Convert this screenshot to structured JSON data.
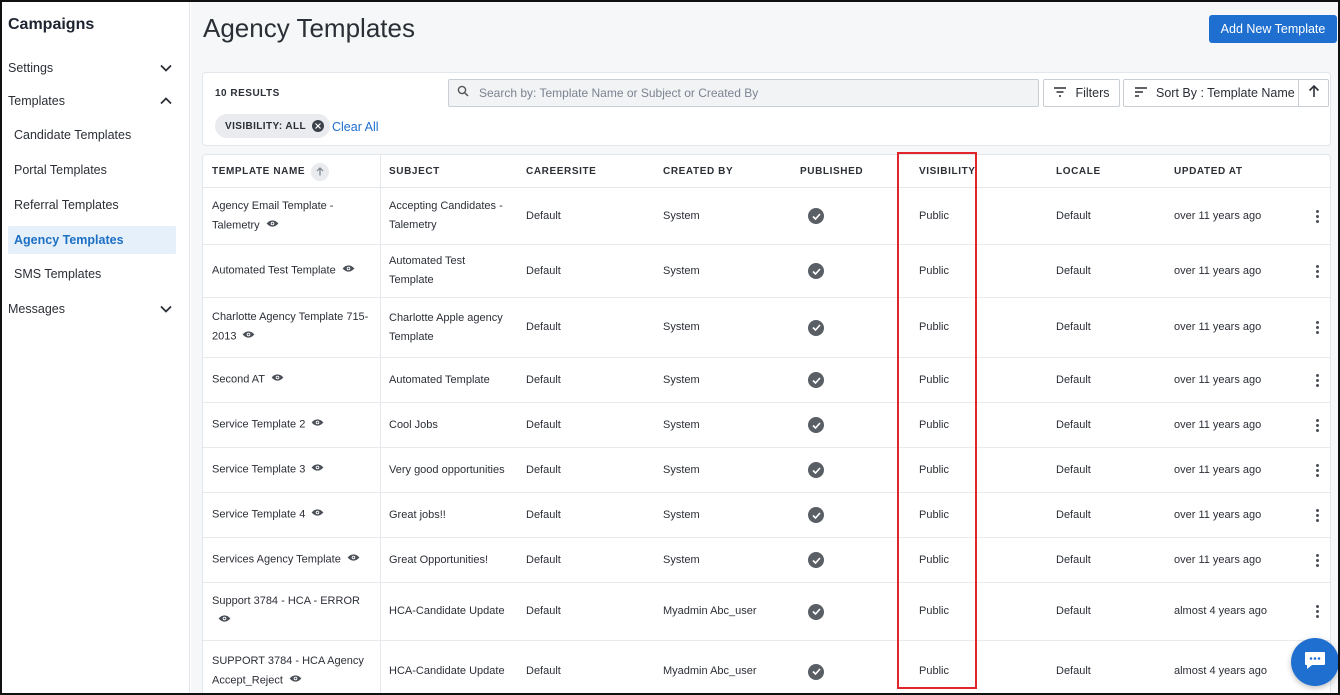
{
  "sidebar": {
    "title": "Campaigns",
    "sections": [
      {
        "label": "Settings",
        "expanded": false
      },
      {
        "label": "Templates",
        "expanded": true
      },
      {
        "label": "Messages",
        "expanded": false
      }
    ],
    "template_items": [
      {
        "label": "Candidate Templates",
        "active": false
      },
      {
        "label": "Portal Templates",
        "active": false
      },
      {
        "label": "Referral Templates",
        "active": false
      },
      {
        "label": "Agency Templates",
        "active": true
      },
      {
        "label": "SMS Templates",
        "active": false
      }
    ]
  },
  "header": {
    "title": "Agency Templates",
    "add_button": "Add New Template"
  },
  "toolbar": {
    "results": "10 RESULTS",
    "search_placeholder": "Search by: Template Name or Subject or Created By",
    "filters_label": "Filters",
    "sort_label": "Sort By : Template Name",
    "chip_label": "VISIBILITY: ALL",
    "clear_all": "Clear All"
  },
  "table": {
    "columns": [
      "TEMPLATE NAME",
      "SUBJECT",
      "CAREERSITE",
      "CREATED BY",
      "PUBLISHED",
      "VISIBILITY",
      "LOCALE",
      "UPDATED AT"
    ],
    "rows": [
      {
        "name": "Agency Email Template - Talemetry",
        "subject": "Accepting Candidates - Talemetry",
        "careersite": "Default",
        "created_by": "System",
        "published": true,
        "visibility": "Public",
        "locale": "Default",
        "updated_at": "over 11 years ago"
      },
      {
        "name": "Automated Test Template",
        "subject": "Automated Test Template",
        "careersite": "Default",
        "created_by": "System",
        "published": true,
        "visibility": "Public",
        "locale": "Default",
        "updated_at": "over 11 years ago"
      },
      {
        "name": "Charlotte Agency Template 715-2013",
        "subject": "Charlotte Apple agency Template",
        "careersite": "Default",
        "created_by": "System",
        "published": true,
        "visibility": "Public",
        "locale": "Default",
        "updated_at": "over 11 years ago"
      },
      {
        "name": "Second AT",
        "subject": "Automated Template",
        "careersite": "Default",
        "created_by": "System",
        "published": true,
        "visibility": "Public",
        "locale": "Default",
        "updated_at": "over 11 years ago"
      },
      {
        "name": "Service Template 2",
        "subject": "Cool Jobs",
        "careersite": "Default",
        "created_by": "System",
        "published": true,
        "visibility": "Public",
        "locale": "Default",
        "updated_at": "over 11 years ago"
      },
      {
        "name": "Service Template 3",
        "subject": "Very good opportunities",
        "careersite": "Default",
        "created_by": "System",
        "published": true,
        "visibility": "Public",
        "locale": "Default",
        "updated_at": "over 11 years ago"
      },
      {
        "name": "Service Template 4",
        "subject": "Great jobs!!",
        "careersite": "Default",
        "created_by": "System",
        "published": true,
        "visibility": "Public",
        "locale": "Default",
        "updated_at": "over 11 years ago"
      },
      {
        "name": "Services Agency Template",
        "subject": "Great Opportunities!",
        "careersite": "Default",
        "created_by": "System",
        "published": true,
        "visibility": "Public",
        "locale": "Default",
        "updated_at": "over 11 years ago"
      },
      {
        "name": "Support 3784 - HCA - ERROR",
        "subject": "HCA-Candidate Update",
        "careersite": "Default",
        "created_by": "Myadmin Abc_user",
        "published": true,
        "visibility": "Public",
        "locale": "Default",
        "updated_at": "almost 4 years ago"
      },
      {
        "name": "SUPPORT 3784 - HCA Agency Accept_Reject",
        "subject": "HCA-Candidate Update",
        "careersite": "Default",
        "created_by": "Myadmin Abc_user",
        "published": true,
        "visibility": "Public",
        "locale": "Default",
        "updated_at": "almost 4 years ago"
      }
    ]
  },
  "icons": {
    "search": "search-icon",
    "filter": "filter-icon",
    "sort": "sort-icon",
    "sort_direction": "arrow-up-icon",
    "preview": "eye-icon",
    "published": "check-circle-icon",
    "row_menu": "kebab-menu-icon",
    "chat": "chat-icon"
  },
  "colors": {
    "accent": "#1f6fd0",
    "highlight": "#e0262b",
    "active_bg": "#e6f0fb"
  }
}
